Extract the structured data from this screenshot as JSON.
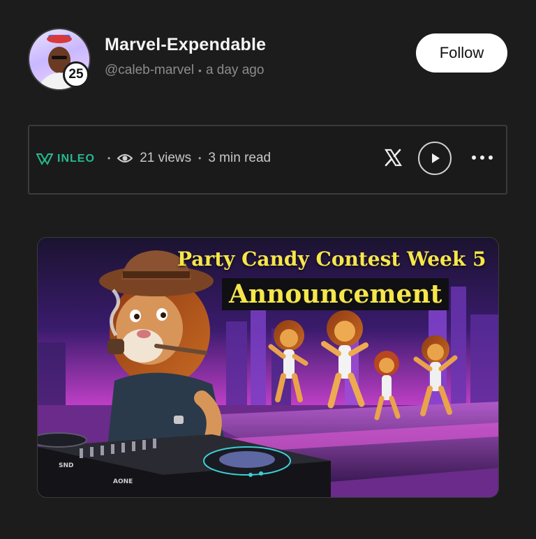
{
  "author": {
    "name": "Marvel-Expendable",
    "handle": "@caleb-marvel",
    "time_ago": "a day ago",
    "reputation": "25",
    "avatar_icon": "user-avatar"
  },
  "follow_label": "Follow",
  "post_stats": {
    "platform": "INLEO",
    "views": "21 views",
    "read_time": "3 min read",
    "share_icon": "x-logo-icon",
    "play_icon": "play-icon",
    "more_icon": "more-dots-icon"
  },
  "cover": {
    "title_line_1": "Party Candy Contest Week 5",
    "title_line_2": "Announcement",
    "deck_label_1": "SND",
    "deck_label_2": "AONE"
  },
  "colors": {
    "background": "#1c1c1d",
    "accent_green": "#27b98c",
    "title_yellow": "#f6e64a"
  }
}
